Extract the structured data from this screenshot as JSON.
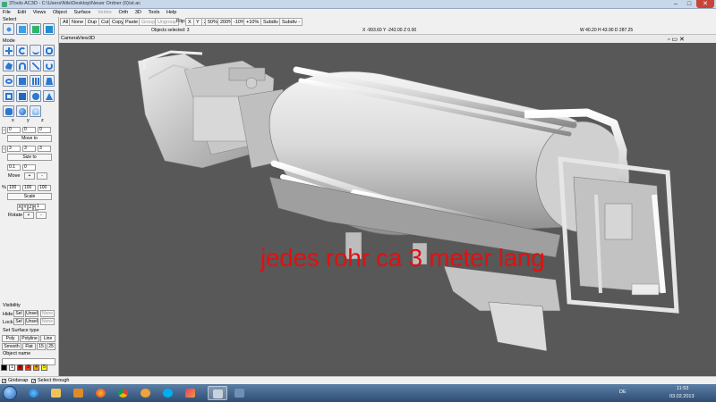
{
  "window": {
    "title": "3Tools AC3D - C:\\Users\\Nils\\Desktop\\Neuer Ordner (6)\\st.ac",
    "controls": [
      "–",
      "□",
      "✕"
    ]
  },
  "menu": [
    "File",
    "Edit",
    "Views",
    "Object",
    "Surface",
    "Vertex",
    "Orth",
    "3D",
    "Tools",
    "Help"
  ],
  "toolbar": {
    "all": "All",
    "none": "None",
    "dup": "Dup",
    "cut": "Cut",
    "copy": "Copy",
    "paste": "Paste",
    "group": "Group",
    "ungroup": "Ungroup",
    "flip_label": "Flip:",
    "flip_x": "X",
    "flip_y": "Y",
    "flip_z": "Z",
    "scale_50": "50%",
    "scale_200": "200%",
    "scale_minus10": "-10%",
    "scale_plus10": "+10%",
    "subdiv_plus": "Subdiv +",
    "subdiv_minus": "Subdiv -"
  },
  "status": {
    "selected": "Objects selected: 3",
    "coords": "X -993.60 Y -242.00 Z 0.00",
    "dims": "W 40.20 H 43.90 D 287.25"
  },
  "panel": {
    "select_label": "Select",
    "mode_label": "Mode",
    "axis_labels": [
      "x",
      "y",
      "z"
    ],
    "move_values": [
      "0",
      "0",
      "0"
    ],
    "move_to": "Move to",
    "size_values": [
      "3",
      "3",
      "3"
    ],
    "size_to": "Size to",
    "step_value": "0.1",
    "step_value2": "0",
    "move": "Move",
    "plus": "+",
    "minus": "-",
    "percent_label": "%",
    "scale_values": [
      "100",
      "100",
      "100"
    ],
    "scale": "Scale",
    "rotate_axes": [
      "X",
      "Y",
      "Z",
      "C"
    ],
    "rotate_value": "1",
    "rotate": "Rotate",
    "visibility_label": "Visibility",
    "hide_label": "Hide:",
    "lock_label": "Lock:",
    "sel": "Sel",
    "unsel": "Unsel",
    "none": "None",
    "surface_label": "Set Surface type",
    "poly": "Poly",
    "polyline": "Polyline",
    "line": "Line",
    "smooth": "Smooth",
    "flat": "Flat",
    "n15": "15",
    "n25": "25",
    "object_name_label": "Object name",
    "palette": [
      {
        "label": "",
        "color": "#000000"
      },
      {
        "label": "1",
        "color": "#ffffff"
      },
      {
        "label": "2",
        "color": "#cc0000"
      },
      {
        "label": "3",
        "color": "#ff3300"
      },
      {
        "label": "4",
        "color": "#ff9900"
      },
      {
        "label": "5",
        "color": "#ffff00"
      }
    ]
  },
  "viewport": {
    "menu": [
      "Camera",
      "View",
      "3D"
    ],
    "annotation": "jedes rohr ca 3 meter lang",
    "bg_color": "#585858"
  },
  "bottombar": {
    "gridsnap": "Gridsnap",
    "select_through": "Select through"
  },
  "taskbar": {
    "lang": "DE",
    "time": "11:53",
    "date": "03.02.2013",
    "apps": [
      "explorer-icon",
      "ie-icon",
      "folder-icon",
      "media-player-icon",
      "firefox-icon",
      "chrome-icon",
      "msn-icon",
      "skype-icon",
      "paint-icon",
      "ac3d-icon",
      "setup-icon"
    ]
  }
}
